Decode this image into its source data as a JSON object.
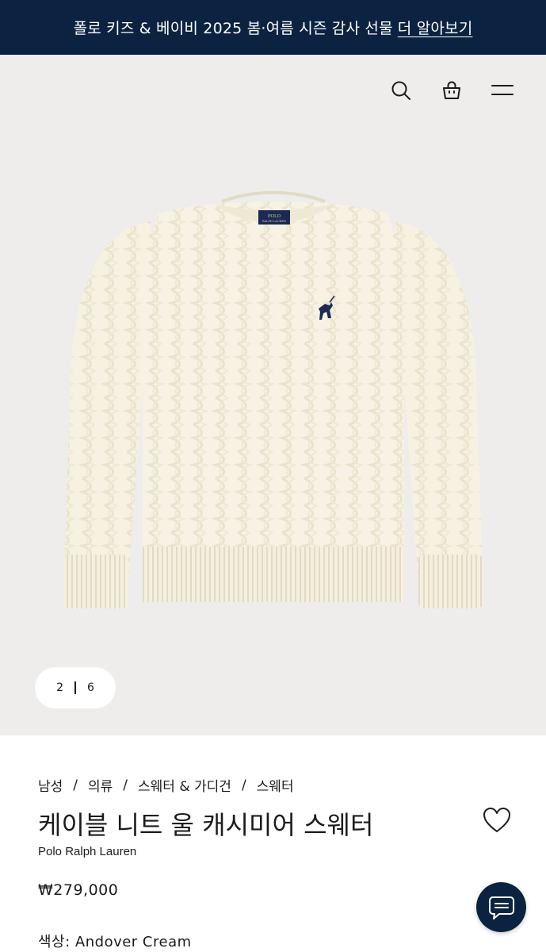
{
  "promo": {
    "text": "폴로 키즈 & 베이비 2025 봄·여름 시즌 감사 선물",
    "link": "더 알아보기"
  },
  "header": {
    "icons": [
      "search-icon",
      "shopping-bag-icon",
      "menu-icon"
    ]
  },
  "gallery": {
    "current": "2",
    "total": "6",
    "image_label_line1": "POLO",
    "image_label_line2": "RALPH LAUREN"
  },
  "breadcrumb": {
    "items": [
      "남성",
      "의류",
      "스웨터 & 가디건",
      "스웨터"
    ],
    "separator": "/"
  },
  "product": {
    "title": "케이블 니트 울 캐시미어 스웨터",
    "brand": "Polo Ralph Lauren",
    "price": "₩279,000",
    "color_label": "색상:",
    "color_value": "Andover Cream"
  },
  "colors": {
    "promo_bg": "#0b2340",
    "hero_bg": "#eeedec",
    "sweater": "#f6f1e1",
    "chat_bg": "#0b2340"
  }
}
